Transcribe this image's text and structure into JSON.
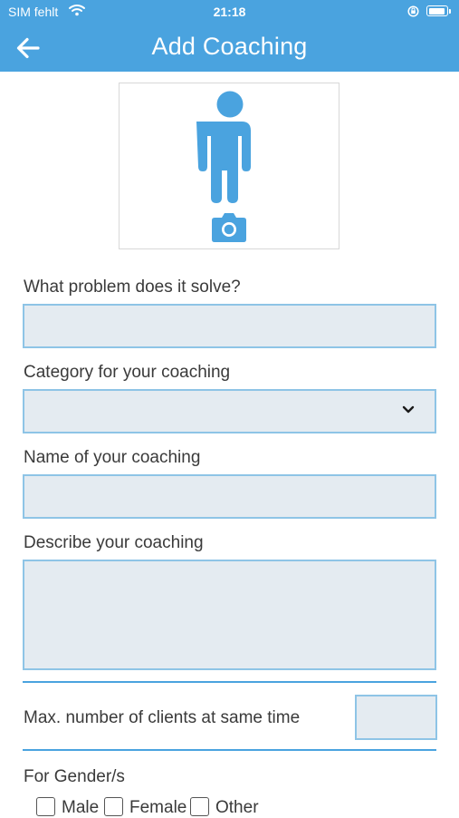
{
  "status_bar": {
    "carrier": "SIM fehlt",
    "time": "21:18",
    "wifi_icon": "wifi-icon",
    "lock_icon": "orientation-lock-icon",
    "battery_icon": "battery-icon"
  },
  "header": {
    "title": "Add Coaching",
    "back_icon": "arrow-left-icon",
    "background": "#4aa3df"
  },
  "photo": {
    "avatar_icon": "person-icon",
    "camera_icon": "camera-icon",
    "accent": "#4aa3df"
  },
  "form": {
    "problem": {
      "label": "What problem does it solve?",
      "value": ""
    },
    "category": {
      "label": "Category for your coaching",
      "value": "",
      "icon": "chevron-down-icon"
    },
    "name": {
      "label": "Name of your coaching",
      "value": ""
    },
    "description": {
      "label": "Describe your coaching",
      "value": ""
    },
    "max_clients": {
      "label": "Max. number of clients at same time",
      "value": ""
    },
    "gender": {
      "label": "For Gender/s",
      "options": [
        {
          "label": "Male",
          "checked": false
        },
        {
          "label": "Female",
          "checked": false
        },
        {
          "label": "Other",
          "checked": false
        }
      ]
    }
  }
}
